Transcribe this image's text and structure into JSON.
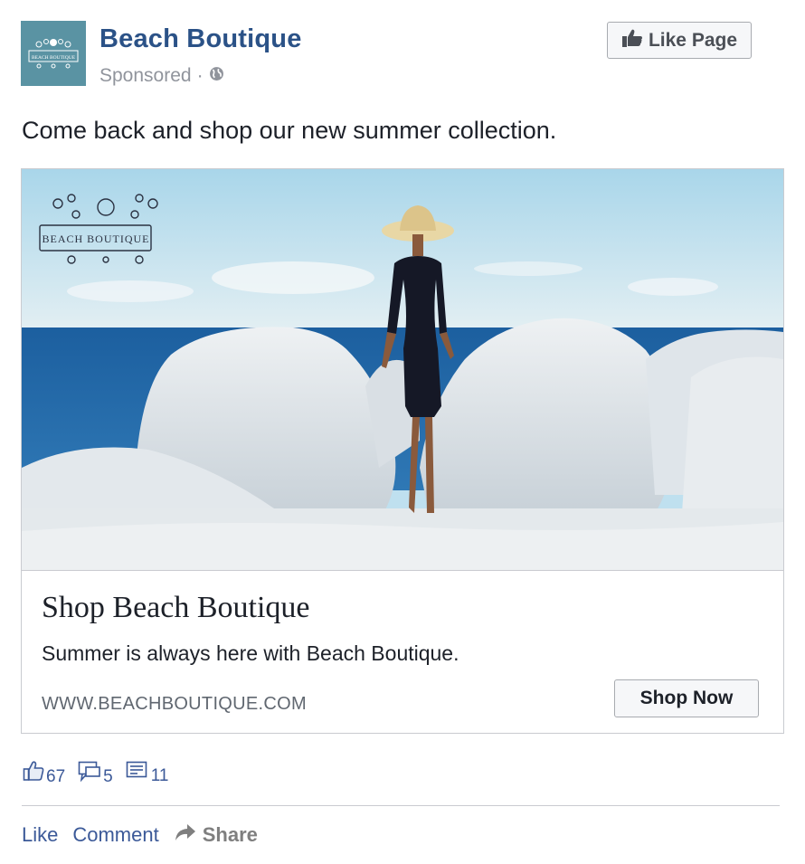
{
  "header": {
    "page_name": "Beach Boutique",
    "sponsored": "Sponsored",
    "separator": "·",
    "like_page_label": "Like Page",
    "avatar_text": "BEACH BOUTIQUE"
  },
  "post": {
    "text": "Come back and shop our new summer collection."
  },
  "card": {
    "logo_text": "BEACH BOUTIQUE",
    "headline": "Shop Beach Boutique",
    "description": "Summer is always here with Beach Boutique.",
    "domain": "WWW.BEACHBOUTIQUE.COM",
    "cta_label": "Shop Now"
  },
  "stats": {
    "likes": "67",
    "comments": "5",
    "shares": "11"
  },
  "actions": {
    "like": "Like",
    "comment": "Comment",
    "share": "Share"
  },
  "colors": {
    "brand_blue": "#2b5287",
    "link_blue": "#3b5998",
    "avatar_bg": "#5a93a3",
    "sea": "#1f5fa0",
    "rock": "#dfe4e8"
  },
  "icons": [
    "globe-icon",
    "thumbs-up-icon",
    "like-icon",
    "comment-icon",
    "share-count-icon",
    "share-arrow-icon"
  ]
}
